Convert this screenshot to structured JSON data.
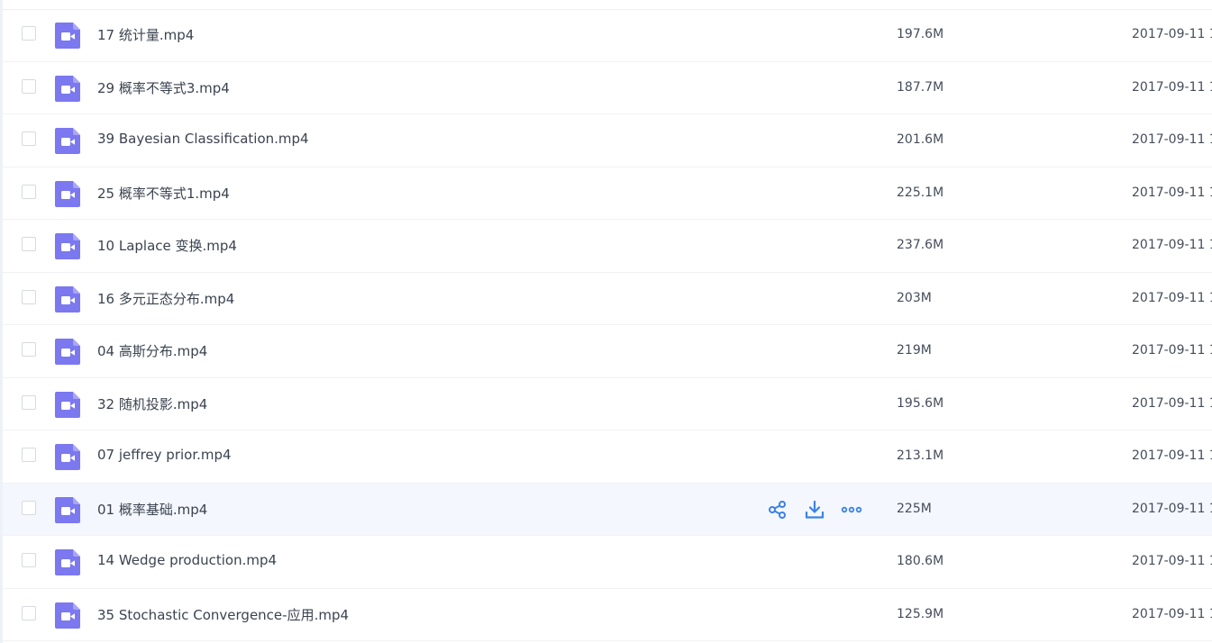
{
  "files": [
    {
      "name": "17 统计量.mp4",
      "size": "197.6M",
      "date": "2017-09-11 1"
    },
    {
      "name": "29 概率不等式3.mp4",
      "size": "187.7M",
      "date": "2017-09-11 1"
    },
    {
      "name": "39 Bayesian Classification.mp4",
      "size": "201.6M",
      "date": "2017-09-11 1"
    },
    {
      "name": "25 概率不等式1.mp4",
      "size": "225.1M",
      "date": "2017-09-11 1"
    },
    {
      "name": "10 Laplace 变换.mp4",
      "size": "237.6M",
      "date": "2017-09-11 1"
    },
    {
      "name": "16 多元正态分布.mp4",
      "size": "203M",
      "date": "2017-09-11 1"
    },
    {
      "name": "04 高斯分布.mp4",
      "size": "219M",
      "date": "2017-09-11 1"
    },
    {
      "name": "32 随机投影.mp4",
      "size": "195.6M",
      "date": "2017-09-11 1"
    },
    {
      "name": "07 jeffrey prior.mp4",
      "size": "213.1M",
      "date": "2017-09-11 1"
    },
    {
      "name": "01 概率基础.mp4",
      "size": "225M",
      "date": "2017-09-11 1",
      "hovered": true
    },
    {
      "name": "14 Wedge production.mp4",
      "size": "180.6M",
      "date": "2017-09-11 1"
    },
    {
      "name": "35 Stochastic Convergence-应用.mp4",
      "size": "125.9M",
      "date": "2017-09-11 1"
    }
  ],
  "row_actions": [
    {
      "icon": "share-icon"
    },
    {
      "icon": "download-icon"
    },
    {
      "icon": "more-icon"
    }
  ],
  "colors": {
    "accent": "#3b82e8",
    "video_icon": "#7b78f0",
    "hover_row": "#f4f7fd"
  }
}
